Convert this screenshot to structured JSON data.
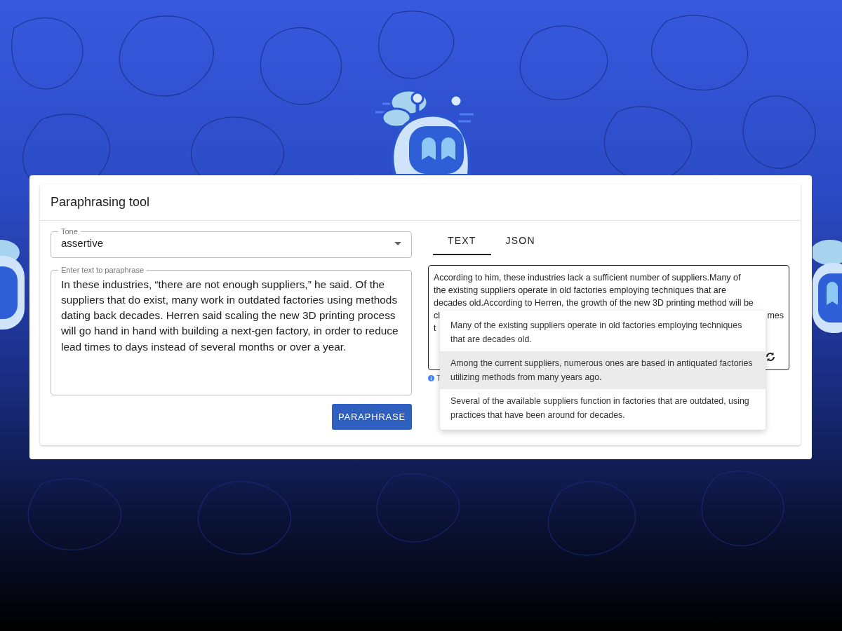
{
  "card": {
    "title": "Paraphrasing tool"
  },
  "tone": {
    "label": "Tone",
    "value": "assertive"
  },
  "input": {
    "label": "Enter text to paraphrase",
    "value": "In these industries, “there are not enough suppliers,” he said. Of the suppliers that do exist, many work in outdated factories using methods dating back decades. Herren said scaling the new 3D printing process will go hand in hand with building a next-gen factory, in order to reduce lead times to days instead of several months or over a year."
  },
  "paraphrase_button": {
    "label": "PARAPHRASE"
  },
  "tabs": [
    {
      "label": "TEXT",
      "selected": true
    },
    {
      "label": "JSON",
      "selected": false
    }
  ],
  "output": {
    "lines": [
      {
        "left": "According to him, these industries lack a sufficient number of suppliers.Many of"
      },
      {
        "left": "the existing suppliers operate in old factories employing techniques that are"
      },
      {
        "left": "decades old.According to Herren, the growth of the new 3D printing method will be"
      },
      {
        "left": "cl",
        "right": "mes"
      },
      {
        "left": "t"
      }
    ],
    "hint": "T"
  },
  "suggestions": [
    {
      "text": "Many of the existing suppliers operate in old factories employing techniques that are decades old.",
      "selected": false
    },
    {
      "text": "Among the current suppliers, numerous ones are based in antiquated factories utilizing methods from many years ago.",
      "selected": true
    },
    {
      "text": "Several of the available suppliers function in factories that are outdated, using practices that have been around for decades.",
      "selected": false
    }
  ]
}
